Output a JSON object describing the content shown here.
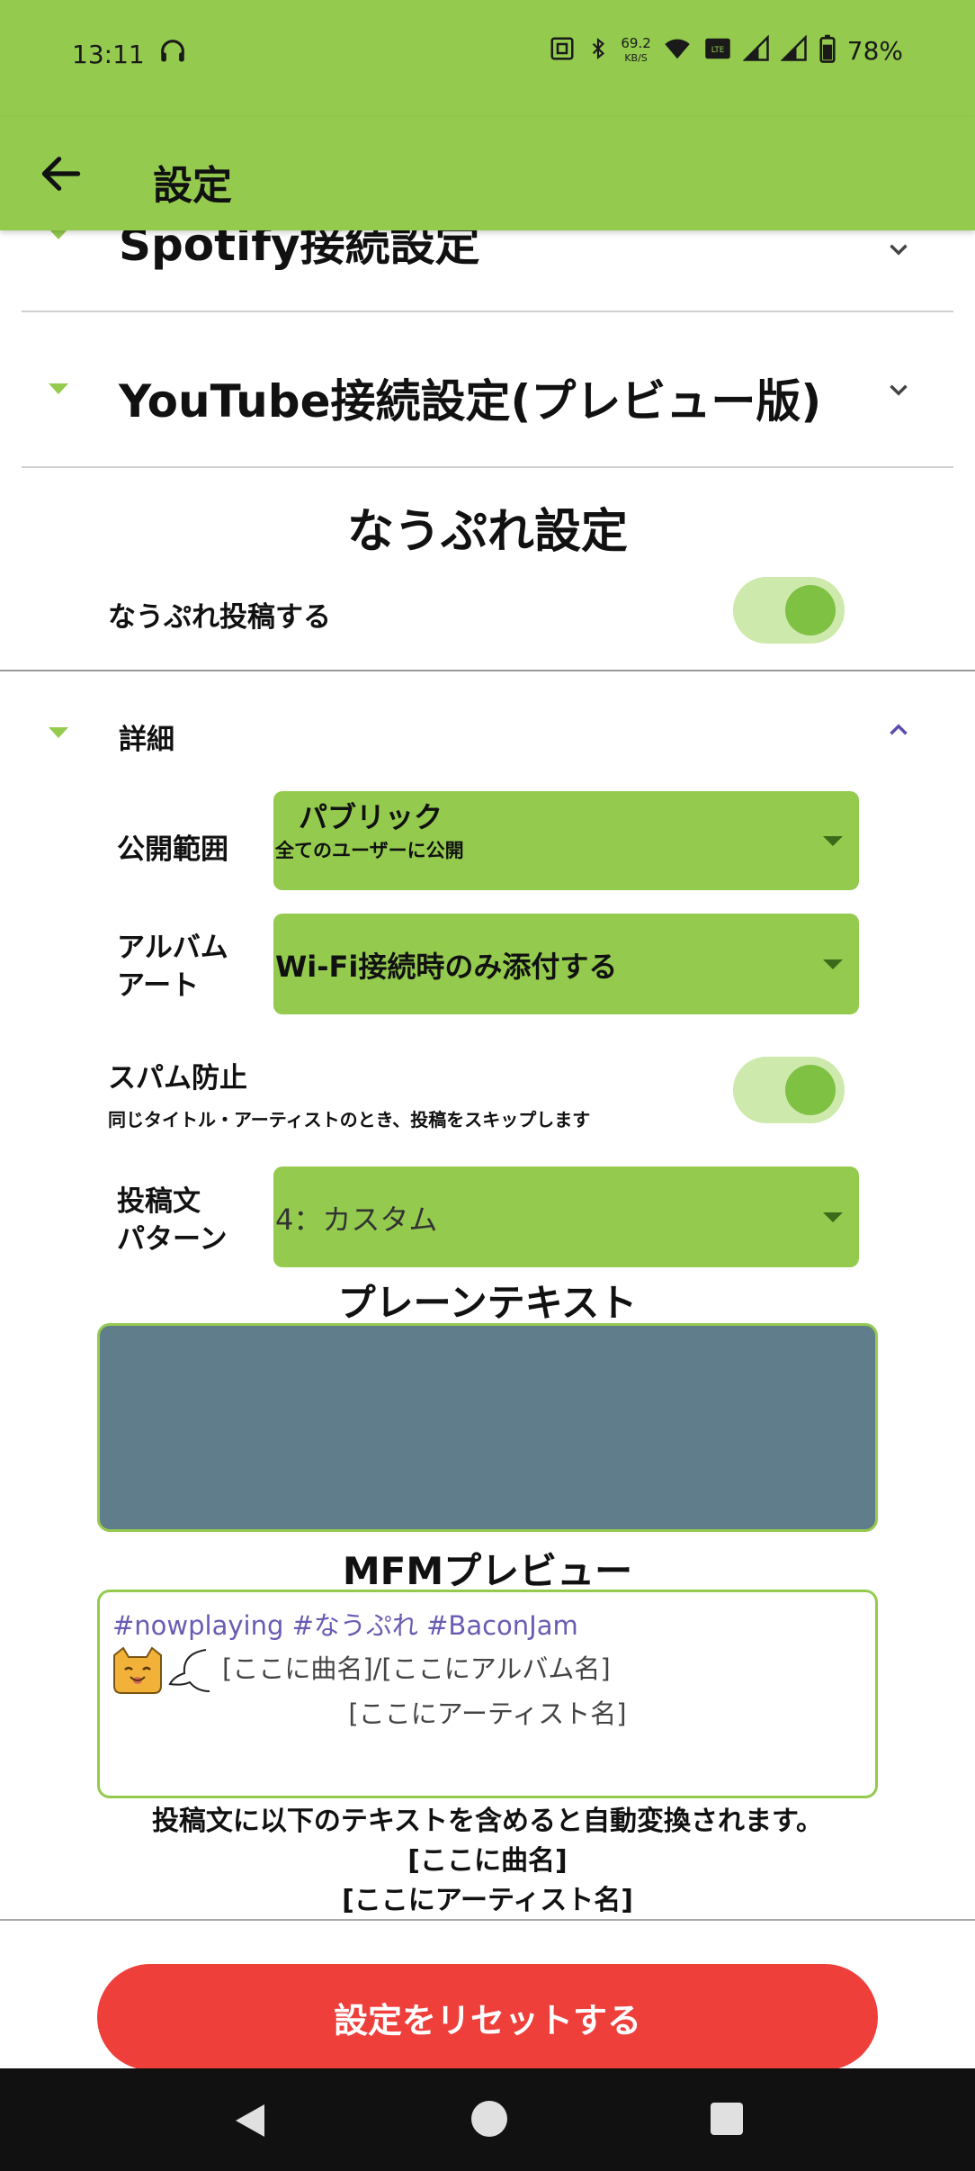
{
  "status_bar": {
    "time": "13:11",
    "net_speed_value": "69.2",
    "net_speed_unit": "KB/S",
    "volte_label": "Vo LTE",
    "battery": "78%"
  },
  "app_bar": {
    "title": "設定"
  },
  "sections": {
    "spotify": "Spotify接続設定",
    "youtube": "YouTube接続設定(プレビュー版)"
  },
  "nowplaying": {
    "title": "なうぷれ設定",
    "post_toggle_label": "なうぷれ投稿する",
    "post_toggle_on": true,
    "details_label": "詳細",
    "visibility": {
      "label": "公開範囲",
      "value": "パブリック",
      "description": "全てのユーザーに公開"
    },
    "album_art": {
      "label_line1": "アルバム",
      "label_line2": "アート",
      "value": "Wi-Fi接続時のみ添付する"
    },
    "spam": {
      "label": "スパム防止",
      "description": "同じタイトル・アーティストのとき、投稿をスキップします",
      "on": true
    },
    "pattern": {
      "label_line1": "投稿文",
      "label_line2": "パターン",
      "value": "4：カスタム"
    },
    "plain_text_title": "プレーンテキスト",
    "mfm_title": "MFMプレビュー",
    "mfm_preview": {
      "tags": "#nowplaying #なうぷれ #BaconJam",
      "line1": "[ここに曲名]/[ここにアルバム名]",
      "line2": "[ここにアーティスト名]"
    },
    "help": {
      "line1": "投稿文に以下のテキストを含めると自動変換されます。",
      "line2": "[ここに曲名]",
      "line3": "[ここにアーティスト名]"
    }
  },
  "reset_button": "設定をリセットする",
  "colors": {
    "accent": "#94cb4e",
    "danger": "#ee3f3b",
    "tag": "#6a5bb3",
    "plain_box": "#607d8b"
  }
}
